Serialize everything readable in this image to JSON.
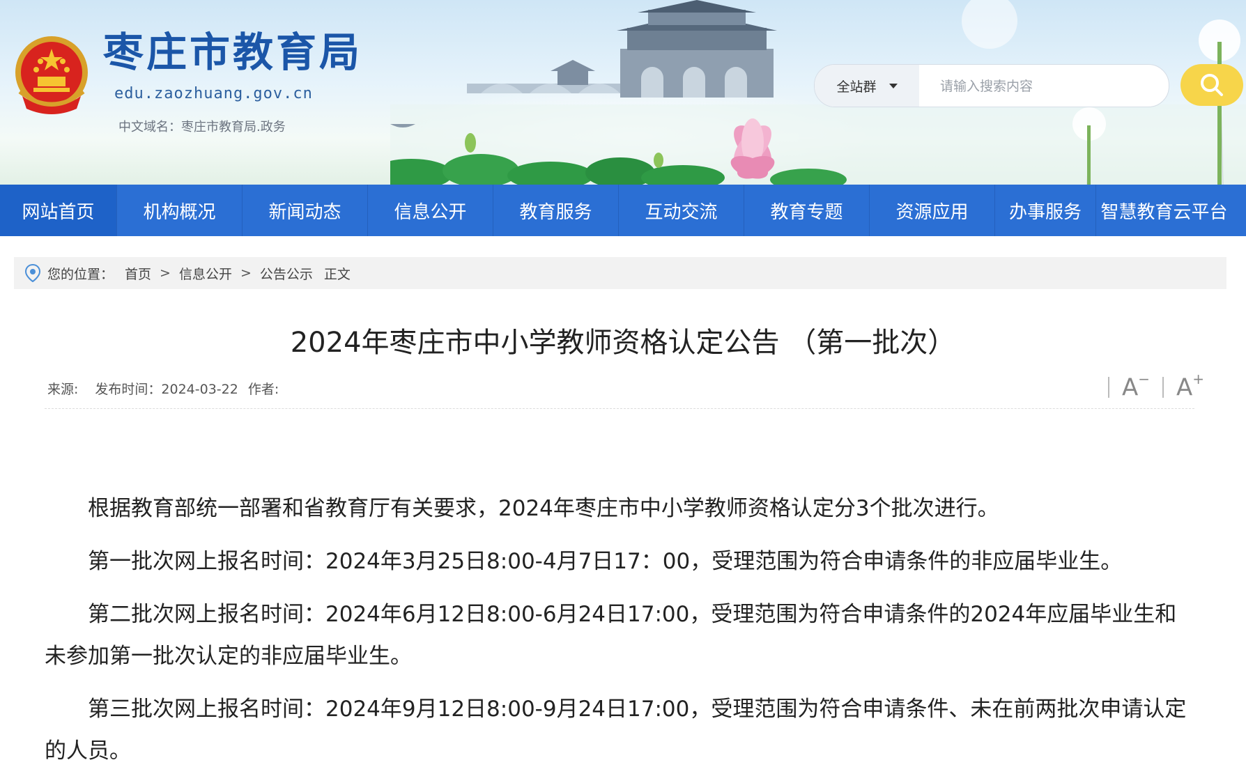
{
  "header": {
    "site_title": "枣庄市教育局",
    "site_domain": "edu.zaozhuang.gov.cn",
    "cn_domain": "中文域名：枣庄市教育局.政务"
  },
  "search": {
    "scope_label": "全站群",
    "placeholder": "请输入搜索内容"
  },
  "nav": {
    "items": [
      {
        "label": "网站首页",
        "active": true
      },
      {
        "label": "机构概况"
      },
      {
        "label": "新闻动态"
      },
      {
        "label": "信息公开"
      },
      {
        "label": "教育服务"
      },
      {
        "label": "互动交流"
      },
      {
        "label": "教育专题"
      },
      {
        "label": "资源应用"
      },
      {
        "label": "办事服务"
      },
      {
        "label": "智慧教育云平台"
      }
    ]
  },
  "breadcrumb": {
    "prefix": "您的位置：",
    "items": [
      "首页",
      "信息公开",
      "公告公示"
    ],
    "separator": ">",
    "current": "正文"
  },
  "article": {
    "title": "2024年枣庄市中小学教师资格认定公告 （第一批次）",
    "source_label": "来源:",
    "publish_label": "发布时间：2024-03-22",
    "author_label": "作者:",
    "font_decrease": "A",
    "font_increase": "A",
    "paragraphs": [
      "根据教育部统一部署和省教育厅有关要求，2024年枣庄市中小学教师资格认定分3个批次进行。",
      "第一批次网上报名时间：2024年3月25日8:00-4月7日17：00，受理范围为符合申请条件的非应届毕业生。",
      "第二批次网上报名时间：2024年6月12日8:00-6月24日17:00，受理范围为符合申请条件的2024年应届毕业生和未参加第一批次认定的非应届毕业生。",
      "第三批次网上报名时间：2024年9月12日8:00-9月24日17:00，受理范围为符合申请条件、未在前两批次申请认定的人员。"
    ]
  },
  "colors": {
    "nav_bg": "#2b6fd4",
    "title_blue": "#1b56a8",
    "search_button": "#f7d54a"
  }
}
